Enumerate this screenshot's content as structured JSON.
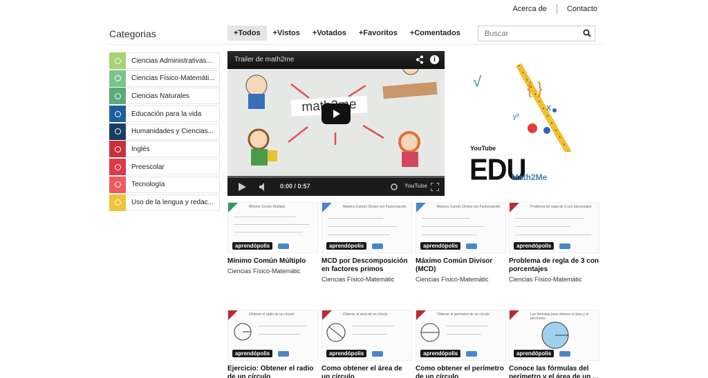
{
  "topnav": {
    "about": "Acerca de",
    "contact": "Contacto"
  },
  "sidebar": {
    "title": "Categorias",
    "items": [
      {
        "label": "Ciencias Administrativas...",
        "color": "#a6d472"
      },
      {
        "label": "Ciencias Físico-Matemáti...",
        "color": "#7cc28a"
      },
      {
        "label": "Ciencias Naturales",
        "color": "#5aaa7c"
      },
      {
        "label": "Educación para la vida",
        "color": "#1f5e9e"
      },
      {
        "label": "Humanidades y Ciencias...",
        "color": "#173e66"
      },
      {
        "label": "Inglés",
        "color": "#c9303a"
      },
      {
        "label": "Preescolar",
        "color": "#dd3b48"
      },
      {
        "label": "Tecnología",
        "color": "#ef5a5f"
      },
      {
        "label": "Uso de la lengua y redac...",
        "color": "#efc33a"
      }
    ]
  },
  "tabs": [
    "+Todos",
    "+Vistos",
    "+Votados",
    "+Favoritos",
    "+Comentados"
  ],
  "search": {
    "placeholder": "Buscar"
  },
  "video": {
    "title": "Trailer de math2me",
    "word": "math2me",
    "time": "0:00 / 0:57",
    "yt": "YouTube"
  },
  "promo": {
    "yt": "YouTube",
    "edu": "EDU",
    "brand": "Math2Me"
  },
  "thumb_brand": "aprendópolis",
  "videos": [
    {
      "title": "Mínimo Común Múltiplo",
      "category": "Ciencias Físico-Matemátic",
      "thumb": "Mínimo Común Múltiplo"
    },
    {
      "title": "MCD por Descomposición en factores primos",
      "category": "Ciencias Físico-Matemátic",
      "thumb": "Máximo Común Divisor por Factorización"
    },
    {
      "title": "Máximo Común Divisor (MCD)",
      "category": "Ciencias Físico-Matemátic",
      "thumb": "Máximo Común Divisor por Factorización"
    },
    {
      "title": "Problema de regla de 3 con porcentajes",
      "category": "Ciencias Físico-Matemátic",
      "thumb": "Problema de regla de 3 con porcentajes"
    },
    {
      "title": "Ejercicio: Obtener el radio de un círculo",
      "category": "",
      "thumb": "Obtener el radio de un círculo"
    },
    {
      "title": "Como obtener el área de un círculo",
      "category": "",
      "thumb": "Obtener el área de un círculo"
    },
    {
      "title": "Como obtener el perímetro de un círculo",
      "category": "",
      "thumb": "Obtener el perímetro de un círculo"
    },
    {
      "title": "Conoce las fórmulas del perímetro y el área de un ...",
      "category": "",
      "thumb": "Las fórmulas para obtener el área y el perímetro"
    }
  ]
}
